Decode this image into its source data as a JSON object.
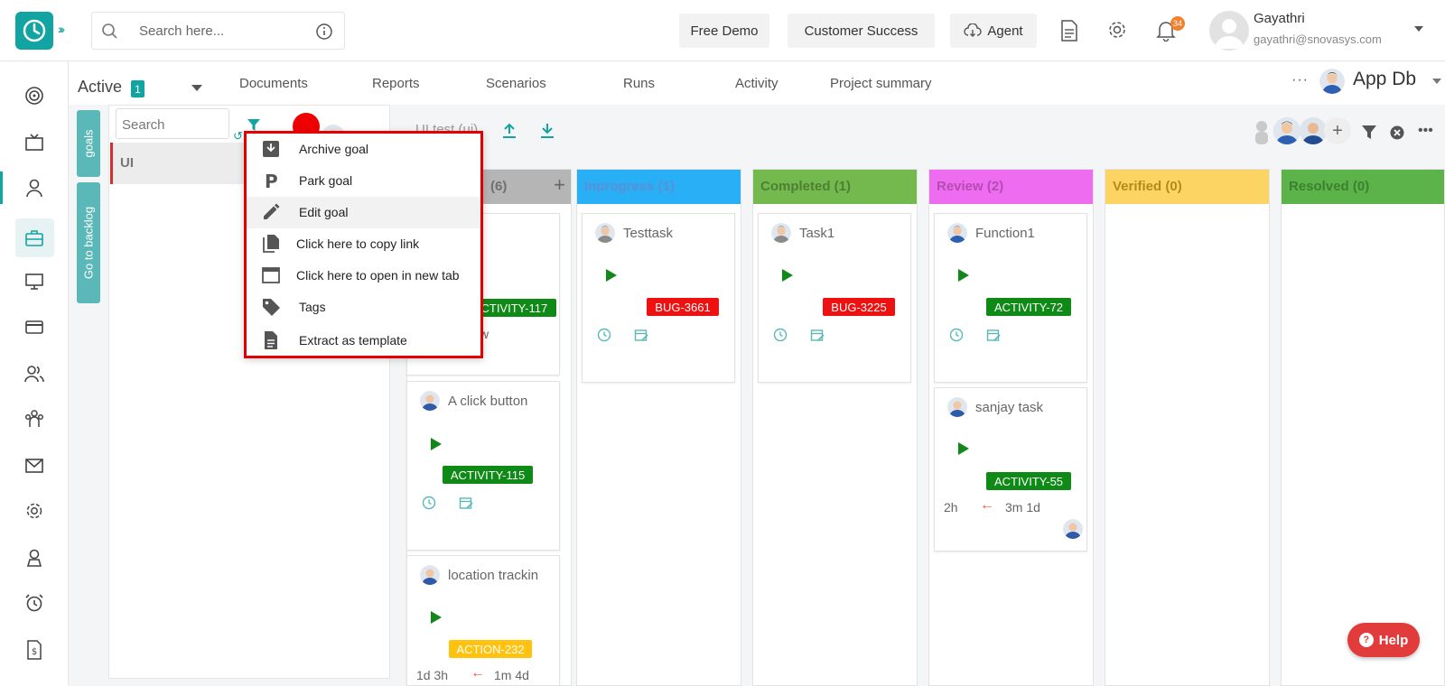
{
  "header": {
    "search_placeholder": "Search here...",
    "free_demo": "Free Demo",
    "customer_success": "Customer Success",
    "agent": "Agent",
    "notification_count": "34",
    "user_name": "Gayathri",
    "user_email": "gayathri@snovasys.com"
  },
  "subheader": {
    "active_label": "Active",
    "active_count": "1",
    "tabs": [
      "Documents",
      "Reports",
      "Scenarios",
      "Runs",
      "Activity",
      "Project summary"
    ],
    "more": "···",
    "project_name": "App Db"
  },
  "goals_panel": {
    "vtab_goals": "goals",
    "vtab_backlog": "Go to backlog",
    "search_placeholder": "Search",
    "goal_item": "UI"
  },
  "context_menu": {
    "items": [
      "Archive goal",
      "Park goal",
      "Edit goal",
      "Click here to copy link",
      "Click here to open in new tab",
      "Tags",
      "Extract as template"
    ]
  },
  "board": {
    "title": "UI test (ui)",
    "columns": [
      {
        "title": "(6)",
        "color": "#b5b5b5"
      },
      {
        "title": "Inprogress (1)",
        "color": "#29aff5"
      },
      {
        "title": "Completed (1)",
        "color": "#73b94d"
      },
      {
        "title": "Review (2)",
        "color": "#ee6cf0"
      },
      {
        "title": "Verified (0)",
        "color": "#fcd464"
      },
      {
        "title": "Resolved (0)",
        "color": "#5bb34a"
      }
    ],
    "cards": {
      "c0a_tag": "ACTIVITY-117",
      "c0a_frag": "w",
      "c0b_title": "A click button",
      "c0b_tag": "ACTIVITY-115",
      "c0c_title": "location trackin",
      "c0c_tag": "ACTION-232",
      "c0c_time1": "1d 3h",
      "c0c_time2": "1m 4d",
      "c1_title": "Testtask",
      "c1_tag": "BUG-3661",
      "c2_title": "Task1",
      "c2_tag": "BUG-3225",
      "c3a_title": "Function1",
      "c3a_tag": "ACTIVITY-72",
      "c3b_title": "sanjay task",
      "c3b_tag": "ACTIVITY-55",
      "c3b_time1": "2h",
      "c3b_time2": "3m 1d"
    }
  },
  "help_label": "Help",
  "colors": {
    "accent": "#12a3a3",
    "menu_border": "#e40000",
    "tag_green": "#0f8a16",
    "tag_red": "#ee1111",
    "tag_amber": "#ffc20e"
  }
}
